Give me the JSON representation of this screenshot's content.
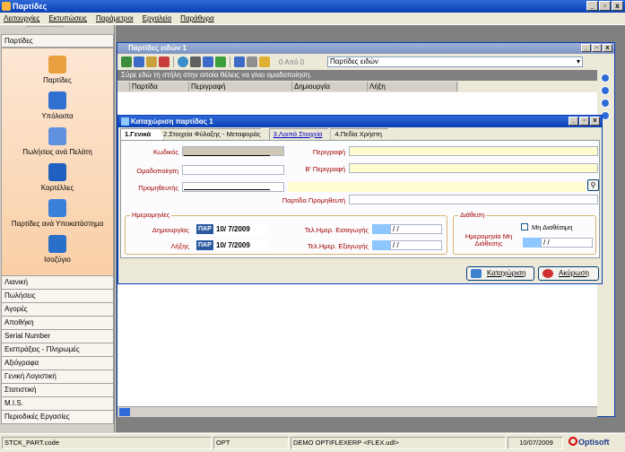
{
  "app": {
    "title": "Παρτίδες"
  },
  "menubar": [
    "Λειτουργίες",
    "Εκτυπώσεις",
    "Παράμετροι",
    "Εργαλεία",
    "Παράθυρα"
  ],
  "left_panel": {
    "header": "Παρτίδες",
    "items": [
      "Παρτίδες",
      "Υπόλοιπα",
      "Πωλήσεις ανά Πελάτη",
      "Καρτέλλες",
      "Παρτίδες ανά Υποκατάστημα",
      "Ισοζύγιο"
    ],
    "categories": [
      "Λιανική",
      "Πωλήσεις",
      "Αγορές",
      "Αποθήκη",
      "Serial Number",
      "Εισπράξεις - Πληρωμές",
      "Αξιόγραφα",
      "Γενική Λογιστική",
      "Στατιστική",
      "M.I.S.",
      "Περιοδικές Εργασίες"
    ]
  },
  "child_window": {
    "title": "Παρτίδες ειδών 1",
    "record_counter": "0 Από 0",
    "combo_value": "Παρτίδες ειδών",
    "group_hint": "Σύρε εδώ τη στήλη στην οποία θέλεις να γίνει ομαδοποίηση.",
    "columns": [
      "Παρτίδα",
      "Περιγραφή",
      "Δημιουργία",
      "Λήξη"
    ]
  },
  "dialog": {
    "title": "Καταχώριση παρτίδας 1",
    "tabs": [
      "1.Γενικά",
      "2.Στοιχεία Φύλαξης - Μεταφοράς",
      "3.Λοιπά Στοιχεία",
      "4.Πεδία Χρήστη"
    ],
    "labels": {
      "code": "Κωδικός",
      "grouping": "Ομαδοποίηση",
      "supplier": "Προμηθευτής",
      "description": "Περιγραφή",
      "desc_b": "Β' Περιγραφή",
      "supplier_batch": "Παρτίδα Προμηθευτή"
    },
    "dates_group": {
      "legend": "Ημερομηνίες",
      "created_label": "Δημιουργίας",
      "expiry_label": "Λήξης",
      "par": "ΠΑΡ",
      "created_value": "10/ 7/2009",
      "expiry_value": "10/ 7/2009",
      "entry_label": "Τελ.Ημερ. Εισαγωγής",
      "exit_label": "Τελ.Ημερ. Εξαγωγής",
      "entry_value": "/  /",
      "exit_value": "/  /"
    },
    "availability_group": {
      "legend": "Διάθεση",
      "unavailable_label": "Μη Διαθέσιμη",
      "unavail_date_label": "Ημερομηνία Μη Διάθεσης",
      "unavail_date_value": "/  /"
    },
    "save_button": "Καταχώριση",
    "cancel_button": "Ακύρωση"
  },
  "statusbar": {
    "form": "STCK_PART.code",
    "module": "OPT",
    "company": "DEMO OPTIFLEXERP <FLEX.udl>",
    "date": "10/07/2009",
    "logo": "Optisoft"
  },
  "colors": {
    "accent": "#0a3fb5",
    "label_red": "#a00000",
    "field_yellow": "#fffdd0"
  }
}
